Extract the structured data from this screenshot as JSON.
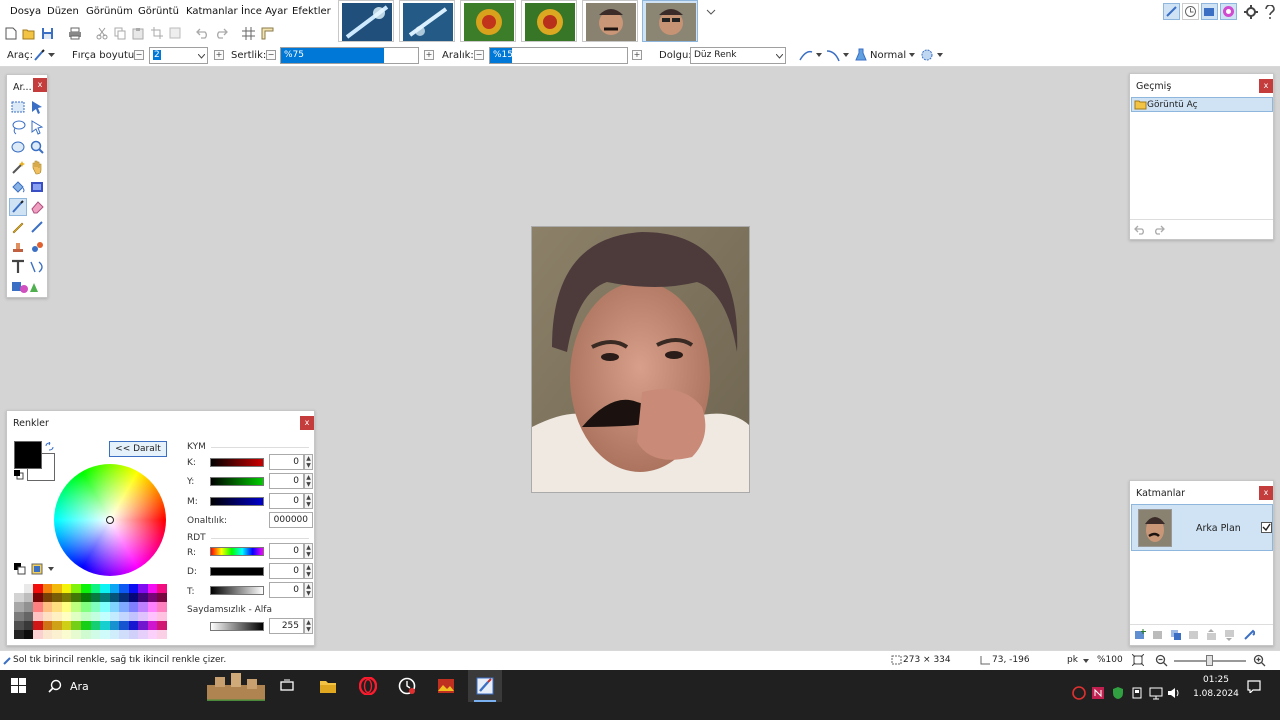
{
  "menu": [
    "Dosya",
    "Düzen",
    "Görünüm",
    "Görüntü",
    "Katmanlar",
    "İnce Ayar",
    "Efektler"
  ],
  "toolbar": {
    "tool_label": "Araç:",
    "brush_size_label": "Fırça boyutu:",
    "brush_size_value": "2",
    "hardness_label": "Sertlik:",
    "hardness_value": "%75",
    "hardness_fraction": 0.75,
    "spacing_label": "Aralık:",
    "spacing_value": "%15",
    "fill_label": "Dolgu:",
    "fill_value": "Düz Renk",
    "blend_mode": "Normal"
  },
  "tools_panel": {
    "title": "Ar..."
  },
  "history": {
    "title": "Geçmiş",
    "items": [
      {
        "label": "Görüntü Aç"
      }
    ]
  },
  "layers": {
    "title": "Katmanlar",
    "items": [
      {
        "label": "Arka Plan",
        "visible": true
      }
    ]
  },
  "colors": {
    "title": "Renkler",
    "collapse_label": "<< Daralt",
    "cmy_label": "KYM",
    "c_label": "K:",
    "c_value": "0",
    "m_label": "Y:",
    "m_value": "0",
    "y_label": "M:",
    "y_value": "0",
    "hex_label": "Onaltılık:",
    "hex_value": "000000",
    "rgb_label": "RDT",
    "r_label": "R:",
    "r_value": "0",
    "g_label": "D:",
    "g_value": "0",
    "b_label": "T:",
    "b_value": "0",
    "alpha_label": "Saydamsızlık - Alfa",
    "alpha_value": "255",
    "primary": "#000000",
    "secondary": "#ffffff"
  },
  "status": {
    "hint": "Sol tık birincil renkle, sağ tık ikincil renkle çizer.",
    "image_size": "273 × 334",
    "cursor_pos": "73, -196",
    "unit": "pk",
    "zoom": "%100"
  },
  "taskbar": {
    "search_placeholder": "Ara",
    "time": "01:25",
    "date": "1.08.2024"
  },
  "theme": {
    "accent": "#0078d7",
    "close": "#c43c3c",
    "selection": "#cfe3f5"
  }
}
